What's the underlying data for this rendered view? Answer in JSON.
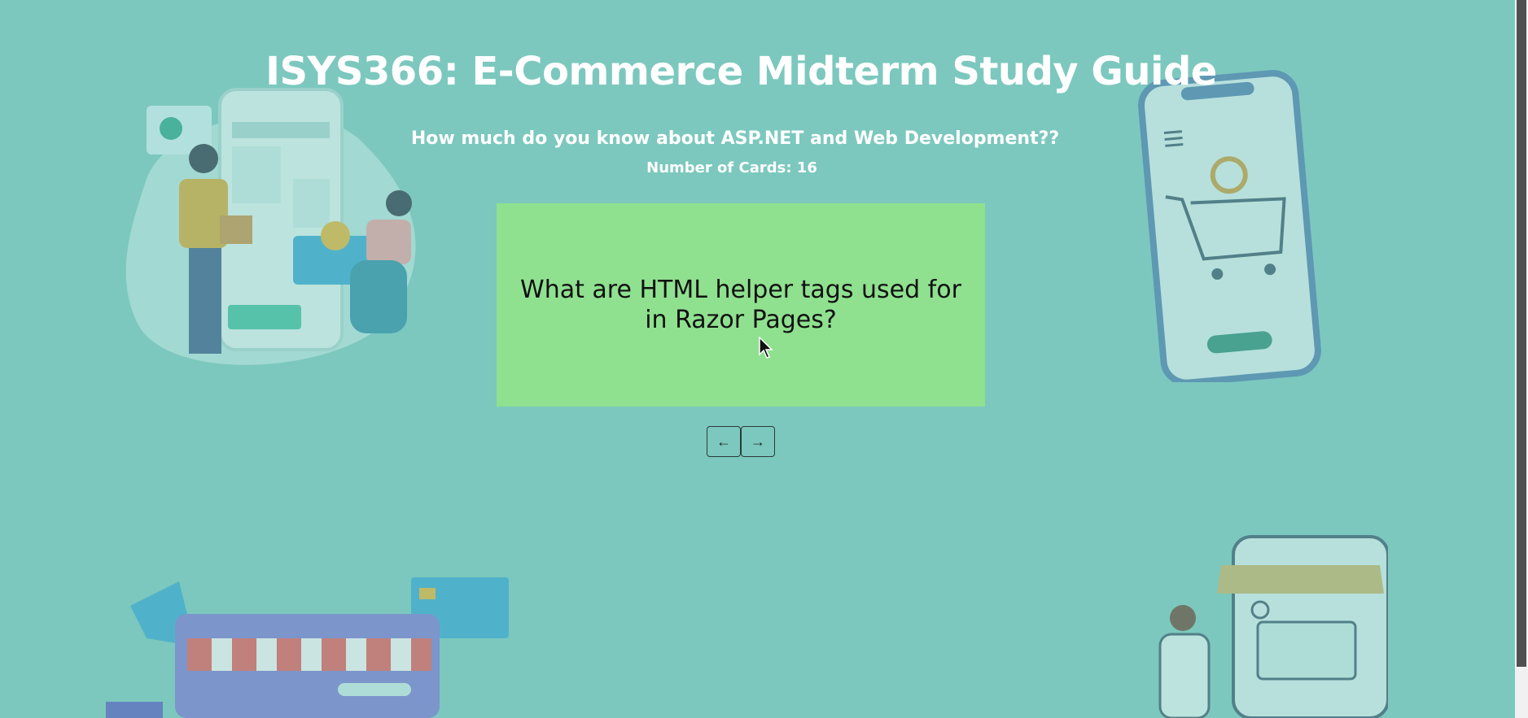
{
  "page": {
    "title": "ISYS366: E-Commerce Midterm Study Guide",
    "subtitle": "How much do you know about ASP.NET and Web Development??",
    "card_count": "Number of Cards: 16"
  },
  "flashcard": {
    "text": "What are HTML helper tags used for in Razor Pages?"
  },
  "navigation": {
    "prev_label": "←",
    "next_label": "→"
  },
  "colors": {
    "background": "#7cc8be",
    "card": "#8fe18f"
  },
  "icons": [
    "previous-arrow-icon",
    "next-arrow-icon",
    "mouse-cursor-icon"
  ]
}
